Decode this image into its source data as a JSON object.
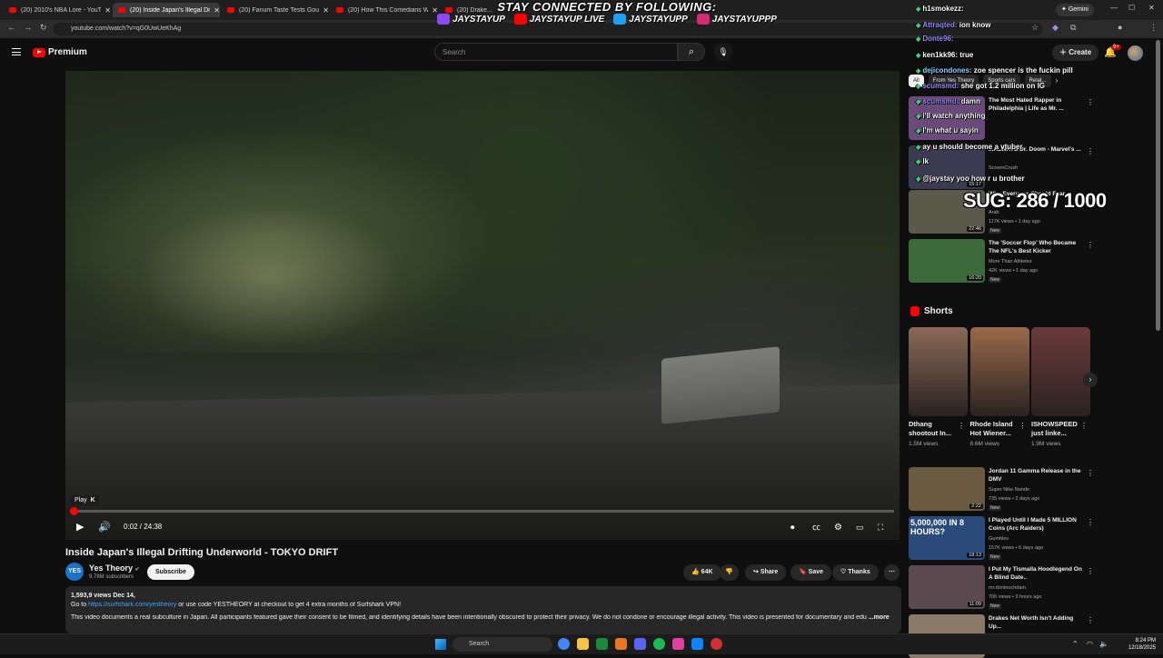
{
  "browser": {
    "tabs": [
      {
        "label": "(20) 2010's NBA Lore - YouTube",
        "active": false
      },
      {
        "label": "(20) Inside Japan's Illegal Drifti...",
        "active": true
      },
      {
        "label": "(20) Fanum Taste Tests Gourme...",
        "active": false
      },
      {
        "label": "(20) How This Comedians Wife...",
        "active": false
      },
      {
        "label": "(20) Drake...",
        "active": false
      }
    ],
    "url": "youtube.com/watch?v=qG0UwUeKhAg",
    "gemini_label": "Gemini"
  },
  "stream_overlay": {
    "title": "STAY CONNECTED BY FOLLOWING:",
    "socials": [
      {
        "icon": "twitch-icon",
        "label": "JAYSTAYUP",
        "color": "#9146ff"
      },
      {
        "icon": "youtube-icon",
        "label": "JAYSTAYUP LIVE",
        "color": "#ff0000"
      },
      {
        "icon": "twitter-icon",
        "label": "JAYSTAYUPP",
        "color": "#1da1f2"
      },
      {
        "icon": "instagram-icon",
        "label": "JAYSTAYUPPP",
        "color": "#d62976"
      }
    ],
    "sub_goal": "SUG: 286 / 1000"
  },
  "chat": [
    {
      "user": "h1smokezz:",
      "text": "",
      "color": "u1"
    },
    {
      "user": "Attraqted:",
      "text": "ion know",
      "color": "u2"
    },
    {
      "user": "Donte96:",
      "text": "",
      "color": "u2"
    },
    {
      "user": "ken1kk96:",
      "text": "true",
      "color": "u1"
    },
    {
      "user": "dejicondones:",
      "text": "zoe spencer is the fuckin pill",
      "color": "u3"
    },
    {
      "user": "scumsmd:",
      "text": "she got 1.2 million on IG",
      "color": "u2"
    },
    {
      "user": "scumsmd:",
      "text": "damn",
      "color": "u2"
    },
    {
      "user": "",
      "text": "i'll watch anything",
      "color": "u1"
    },
    {
      "user": "",
      "text": "I'm what u sayin",
      "color": "u1"
    },
    {
      "user": "",
      "text": "ay u should become a vtuber",
      "color": "u1"
    },
    {
      "user": "",
      "text": "lk",
      "color": "u1"
    },
    {
      "user": "",
      "text": "@jaystay yoo how r u brother",
      "color": "u1"
    }
  ],
  "header": {
    "logo_label": "Premium",
    "search_placeholder": "Search",
    "create_label": "Create",
    "notification_count": "9+"
  },
  "player": {
    "progress": 0.0014,
    "tooltip_label": "Play",
    "tooltip_key": "K",
    "time": "0:02 / 24:38"
  },
  "video": {
    "title": "Inside Japan's Illegal Drifting Underworld - TOKYO DRIFT",
    "channel_initials": "YES",
    "channel_name": "Yes Theory",
    "subscribers": "9.78M subscribers",
    "subscribe_label": "Subscribe",
    "likes": "64K",
    "share_label": "Share",
    "save_label": "Save",
    "thanks_label": "Thanks",
    "views_line": "1,593,9  views  Dec 14,",
    "desc_prefix": "Go to ",
    "desc_link": "https://surfshark.com/yestheory",
    "desc_suffix": " or use code YESTHEORY at checkout to get 4 extra months of Surfshark VPN!",
    "desc_body": "This video documents a real subculture in Japan. All participants featured gave their consent to be filmed, and identifying details have been intentionally obscured to protect their privacy. We do not condone or encourage illegal activity. This video is presented for documentary and edu",
    "more_label": "...more"
  },
  "sidebar": {
    "chips": [
      "All",
      "From Yes Theory",
      "Sports cars",
      "Relat..."
    ],
    "recommendations_top": [
      {
        "title": "The Most Hated Rapper in Philadelphia | Life as Mr. ...",
        "channel": "",
        "meta": "",
        "new": false,
        "duration": "",
        "thumb": "#6a4a7a"
      },
      {
        "title": "...ALWAYS Dr. Doom - Marvel's ...",
        "channel": "ScreenCrush",
        "meta": "",
        "new": false,
        "duration": "15:17",
        "thumb": "#3a3a50"
      },
      {
        "title": "Why Everyone Should Fear...",
        "channel": "Arab",
        "meta": "117K views • 1 day ago",
        "new": true,
        "duration": "22:46",
        "thumb": "#5a5a4a"
      },
      {
        "title": "The 'Soccer Flop' Who Became The NFL's Best Kicker",
        "channel": "More Than Athletes",
        "meta": "42K views • 1 day ago",
        "new": true,
        "duration": "16:20",
        "thumb": "#3c6a3a"
      }
    ],
    "shorts_title": "Shorts",
    "shorts": [
      {
        "title": "Dthang shootout In...",
        "views": "1.5M views",
        "thumb": "#8a6a58"
      },
      {
        "title": "Rhode Island Hot Wiener...",
        "views": "8.6M views",
        "thumb": "#9a6a4a"
      },
      {
        "title": "ISHOWSPEED just linke...",
        "views": "1.9M views",
        "thumb": "#6a3a3a"
      }
    ],
    "recommendations_bottom": [
      {
        "title": "Jordan 11 Gamma Release in the DMV",
        "channel": "Super Nike Nando",
        "meta": "735 views • 2 days ago",
        "new": true,
        "duration": "2:22",
        "thumb": "#6a5a40"
      },
      {
        "title": "I Played Until I Made 5 MILLION Coins (Arc Raiders)",
        "channel": "Gumbles",
        "meta": "157K views • 6 days ago",
        "new": true,
        "duration": "18:13",
        "thumb": "#2a4a7a",
        "thumb_text": "5,000,000 IN 8 HOURS?"
      },
      {
        "title": "I Put My Tismalla Hoodlegend On A Blind Date..",
        "channel": "mr.dontouchdam",
        "meta": "706 views • 3 hours ago",
        "new": true,
        "duration": "11:09",
        "thumb": "#5a4a50"
      },
      {
        "title": "Drakes Net Worth Isn't Adding Up...",
        "channel": "",
        "meta": "",
        "new": false,
        "duration": "",
        "thumb": "#8a7a6a"
      }
    ]
  },
  "taskbar": {
    "search_placeholder": "Search",
    "time": "8:24 PM",
    "date": "12/18/2025"
  },
  "colors": {
    "background": "#0f0f0f",
    "accent": "#ff0000",
    "link": "#3ea6ff"
  }
}
